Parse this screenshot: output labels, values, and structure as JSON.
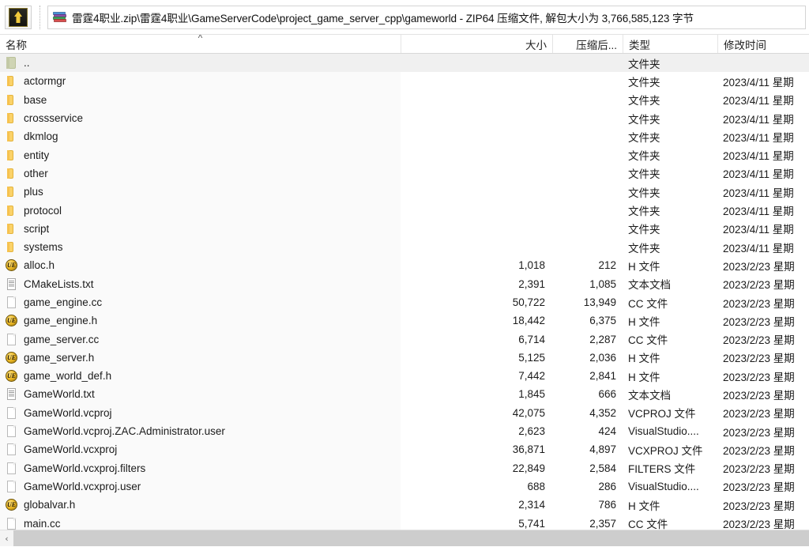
{
  "toolbar": {
    "up_button_tooltip": "上一层",
    "up_icon": "arrow-up-icon",
    "archive_icon": "winrar-archive-icon",
    "address_value": "雷霆4职业.zip\\雷霆4职业\\GameServerCode\\project_game_server_cpp\\gameworld - ZIP64 压缩文件, 解包大小为 3,766,585,123 字节",
    "address_placeholder": ""
  },
  "columns": {
    "name": "名称",
    "size": "大小",
    "compressed": "压缩后...",
    "type": "类型",
    "modified": "修改时间",
    "sort_indicator": "^"
  },
  "rows": [
    {
      "icon": "folder-up-icon",
      "name": "..",
      "size": "",
      "compressed": "",
      "type": "文件夹",
      "modified": "",
      "selected": true
    },
    {
      "icon": "folder-icon",
      "name": "actormgr",
      "size": "",
      "compressed": "",
      "type": "文件夹",
      "modified": "2023/4/11 星期",
      "selected": false
    },
    {
      "icon": "folder-icon",
      "name": "base",
      "size": "",
      "compressed": "",
      "type": "文件夹",
      "modified": "2023/4/11 星期",
      "selected": false
    },
    {
      "icon": "folder-icon",
      "name": "crossservice",
      "size": "",
      "compressed": "",
      "type": "文件夹",
      "modified": "2023/4/11 星期",
      "selected": false
    },
    {
      "icon": "folder-icon",
      "name": "dkmlog",
      "size": "",
      "compressed": "",
      "type": "文件夹",
      "modified": "2023/4/11 星期",
      "selected": false
    },
    {
      "icon": "folder-icon",
      "name": "entity",
      "size": "",
      "compressed": "",
      "type": "文件夹",
      "modified": "2023/4/11 星期",
      "selected": false
    },
    {
      "icon": "folder-icon",
      "name": "other",
      "size": "",
      "compressed": "",
      "type": "文件夹",
      "modified": "2023/4/11 星期",
      "selected": false
    },
    {
      "icon": "folder-icon",
      "name": "plus",
      "size": "",
      "compressed": "",
      "type": "文件夹",
      "modified": "2023/4/11 星期",
      "selected": false
    },
    {
      "icon": "folder-icon",
      "name": "protocol",
      "size": "",
      "compressed": "",
      "type": "文件夹",
      "modified": "2023/4/11 星期",
      "selected": false
    },
    {
      "icon": "folder-icon",
      "name": "script",
      "size": "",
      "compressed": "",
      "type": "文件夹",
      "modified": "2023/4/11 星期",
      "selected": false
    },
    {
      "icon": "folder-icon",
      "name": "systems",
      "size": "",
      "compressed": "",
      "type": "文件夹",
      "modified": "2023/4/11 星期",
      "selected": false
    },
    {
      "icon": "ultraedit-icon",
      "name": "alloc.h",
      "size": "1,018",
      "compressed": "212",
      "type": "H 文件",
      "modified": "2023/2/23 星期",
      "selected": false
    },
    {
      "icon": "text-doc-icon",
      "name": "CMakeLists.txt",
      "size": "2,391",
      "compressed": "1,085",
      "type": "文本文档",
      "modified": "2023/2/23 星期",
      "selected": false
    },
    {
      "icon": "doc-icon",
      "name": "game_engine.cc",
      "size": "50,722",
      "compressed": "13,949",
      "type": "CC 文件",
      "modified": "2023/2/23 星期",
      "selected": false
    },
    {
      "icon": "ultraedit-icon",
      "name": "game_engine.h",
      "size": "18,442",
      "compressed": "6,375",
      "type": "H 文件",
      "modified": "2023/2/23 星期",
      "selected": false
    },
    {
      "icon": "doc-icon",
      "name": "game_server.cc",
      "size": "6,714",
      "compressed": "2,287",
      "type": "CC 文件",
      "modified": "2023/2/23 星期",
      "selected": false
    },
    {
      "icon": "ultraedit-icon",
      "name": "game_server.h",
      "size": "5,125",
      "compressed": "2,036",
      "type": "H 文件",
      "modified": "2023/2/23 星期",
      "selected": false
    },
    {
      "icon": "ultraedit-icon",
      "name": "game_world_def.h",
      "size": "7,442",
      "compressed": "2,841",
      "type": "H 文件",
      "modified": "2023/2/23 星期",
      "selected": false
    },
    {
      "icon": "text-doc-icon",
      "name": "GameWorld.txt",
      "size": "1,845",
      "compressed": "666",
      "type": "文本文档",
      "modified": "2023/2/23 星期",
      "selected": false
    },
    {
      "icon": "doc-icon",
      "name": "GameWorld.vcproj",
      "size": "42,075",
      "compressed": "4,352",
      "type": "VCPROJ 文件",
      "modified": "2023/2/23 星期",
      "selected": false
    },
    {
      "icon": "doc-icon",
      "name": "GameWorld.vcproj.ZAC.Administrator.user",
      "size": "2,623",
      "compressed": "424",
      "type": "VisualStudio....",
      "modified": "2023/2/23 星期",
      "selected": false
    },
    {
      "icon": "doc-icon",
      "name": "GameWorld.vcxproj",
      "size": "36,871",
      "compressed": "4,897",
      "type": "VCXPROJ 文件",
      "modified": "2023/2/23 星期",
      "selected": false
    },
    {
      "icon": "doc-icon",
      "name": "GameWorld.vcxproj.filters",
      "size": "22,849",
      "compressed": "2,584",
      "type": "FILTERS 文件",
      "modified": "2023/2/23 星期",
      "selected": false
    },
    {
      "icon": "doc-icon",
      "name": "GameWorld.vcxproj.user",
      "size": "688",
      "compressed": "286",
      "type": "VisualStudio....",
      "modified": "2023/2/23 星期",
      "selected": false
    },
    {
      "icon": "ultraedit-icon",
      "name": "globalvar.h",
      "size": "2,314",
      "compressed": "786",
      "type": "H 文件",
      "modified": "2023/2/23 星期",
      "selected": false
    },
    {
      "icon": "doc-icon",
      "name": "main.cc",
      "size": "5,741",
      "compressed": "2,357",
      "type": "CC 文件",
      "modified": "2023/2/23 星期",
      "selected": false
    }
  ],
  "scrollbar": {
    "left_arrow": "‹"
  },
  "colors": {
    "selection": "#f0f0f0",
    "name_column_bg": "#fafafa",
    "folder": "#fbd268",
    "scroll_thumb": "#cdcdcd"
  }
}
